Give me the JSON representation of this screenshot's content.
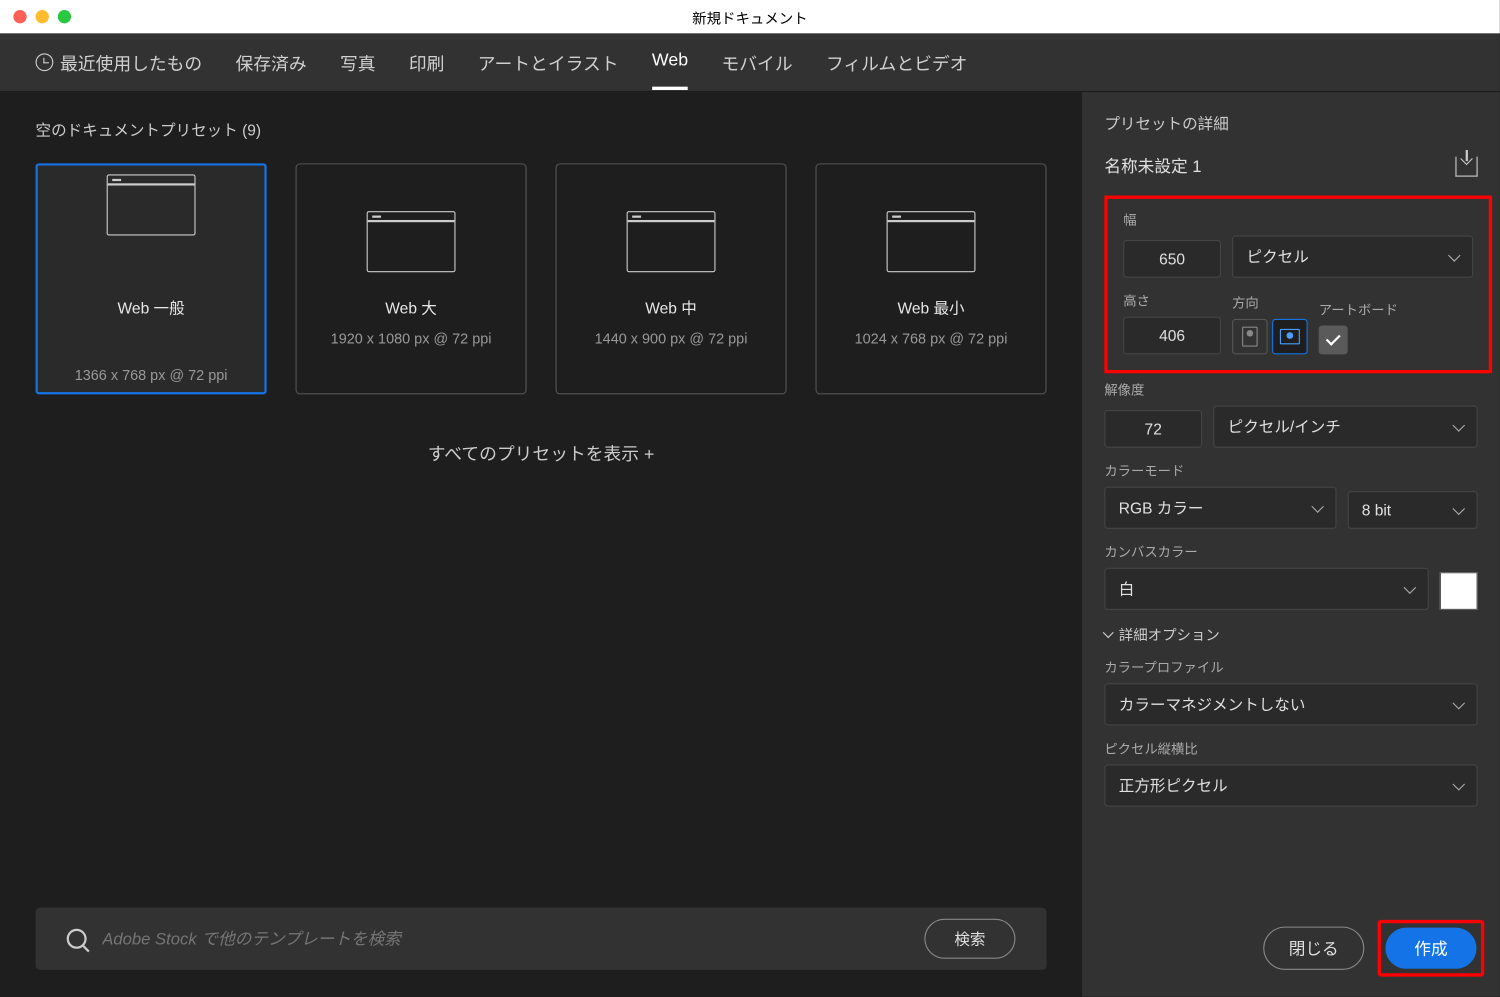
{
  "window": {
    "title": "新規ドキュメント"
  },
  "tabs": [
    "最近使用したもの",
    "保存済み",
    "写真",
    "印刷",
    "アートとイラスト",
    "Web",
    "モバイル",
    "フィルムとビデオ"
  ],
  "activeTab": "Web",
  "presetHeader": "空のドキュメントプリセット (9)",
  "presets": [
    {
      "name": "Web 一般",
      "dim": "1366 x 768 px @ 72 ppi"
    },
    {
      "name": "Web 大",
      "dim": "1920 x 1080 px @ 72 ppi"
    },
    {
      "name": "Web 中",
      "dim": "1440 x 900 px @ 72 ppi"
    },
    {
      "name": "Web 最小",
      "dim": "1024 x 768 px @ 72 ppi"
    }
  ],
  "showAll": "すべてのプリセットを表示 +",
  "search": {
    "placeholder": "Adobe Stock で他のテンプレートを検索",
    "button": "検索"
  },
  "detail": {
    "title": "プリセットの詳細",
    "name": "名称未設定 1",
    "widthLabel": "幅",
    "width": "650",
    "unit": "ピクセル",
    "heightLabel": "高さ",
    "height": "406",
    "orientLabel": "方向",
    "artboardLabel": "アートボード",
    "resLabel": "解像度",
    "res": "72",
    "resUnit": "ピクセル/インチ",
    "colorModeLabel": "カラーモード",
    "colorMode": "RGB カラー",
    "bitDepth": "8 bit",
    "canvasLabel": "カンバスカラー",
    "canvas": "白",
    "advanced": "詳細オプション",
    "profileLabel": "カラープロファイル",
    "profile": "カラーマネジメントしない",
    "aspectLabel": "ピクセル縦横比",
    "aspect": "正方形ピクセル"
  },
  "buttons": {
    "close": "閉じる",
    "create": "作成"
  }
}
